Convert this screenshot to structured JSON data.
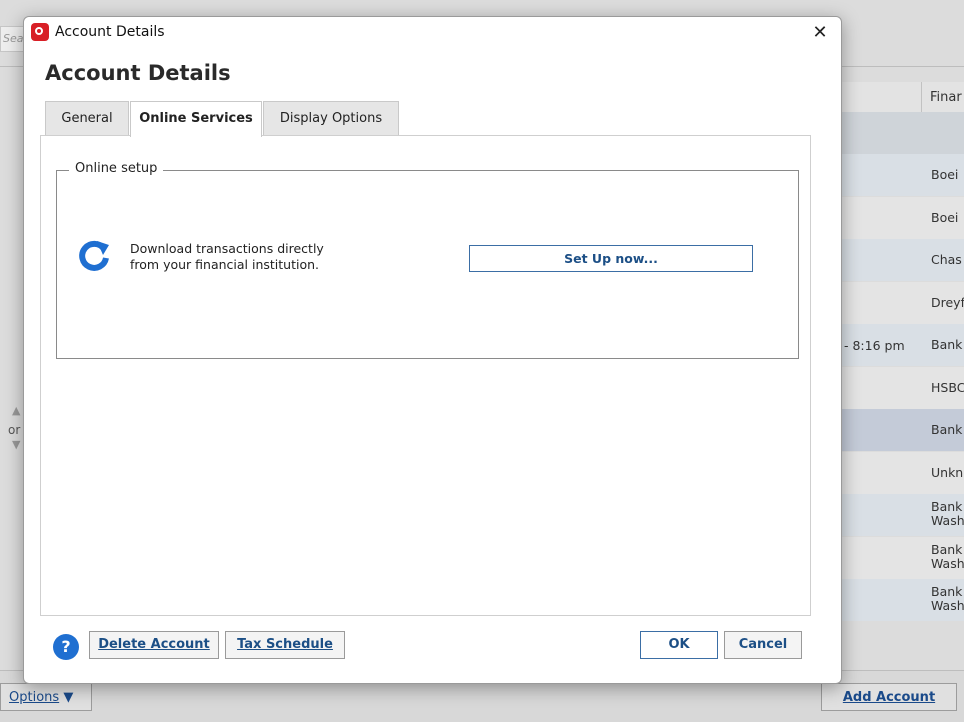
{
  "background": {
    "search_placeholder": "Sear",
    "column_header": "Finar",
    "rows": [
      {
        "name": "Boei",
        "time": "",
        "bg": "#d9dfe5"
      },
      {
        "name": "Boei",
        "time": "",
        "bg": "#e4e4e4"
      },
      {
        "name": "Chas",
        "time": "",
        "bg": "#d9dfe5"
      },
      {
        "name": "Dreyf",
        "time": "",
        "bg": "#e4e4e4"
      },
      {
        "name": "Bank",
        "time": "- 8:16 pm",
        "bg": "#d9dfe5"
      },
      {
        "name": "HSBC",
        "time": "",
        "bg": "#e4e4e4"
      },
      {
        "name": "Bank",
        "time": "",
        "bg": "#c4cbd8"
      },
      {
        "name": "Unkn",
        "time": "",
        "bg": "#e4e4e4"
      },
      {
        "name": "Bank\nWash",
        "time": "",
        "bg": "#d9dfe5"
      },
      {
        "name": "Bank\nWash",
        "time": "",
        "bg": "#e4e4e4"
      },
      {
        "name": "Bank\nWash",
        "time": "",
        "bg": "#d9dfe5"
      }
    ],
    "side_label": "or",
    "options_label": "Options",
    "add_account_label": "Add Account"
  },
  "dialog": {
    "window_title": "Account Details",
    "heading": "Account Details",
    "tabs": [
      {
        "label": "General",
        "active": false
      },
      {
        "label": "Online Services",
        "active": true
      },
      {
        "label": "Display Options",
        "active": false
      }
    ],
    "online_setup": {
      "legend": "Online setup",
      "description": "Download transactions directly from your financial institution.",
      "setup_button": "Set Up now..."
    },
    "footer": {
      "help": "?",
      "delete_account": "Delete Account",
      "tax_schedule": "Tax Schedule",
      "ok": "OK",
      "cancel": "Cancel"
    }
  },
  "colors": {
    "accent_blue": "#1f6fd1",
    "brand_red": "#d81f26",
    "link_blue": "#1c4f86"
  }
}
